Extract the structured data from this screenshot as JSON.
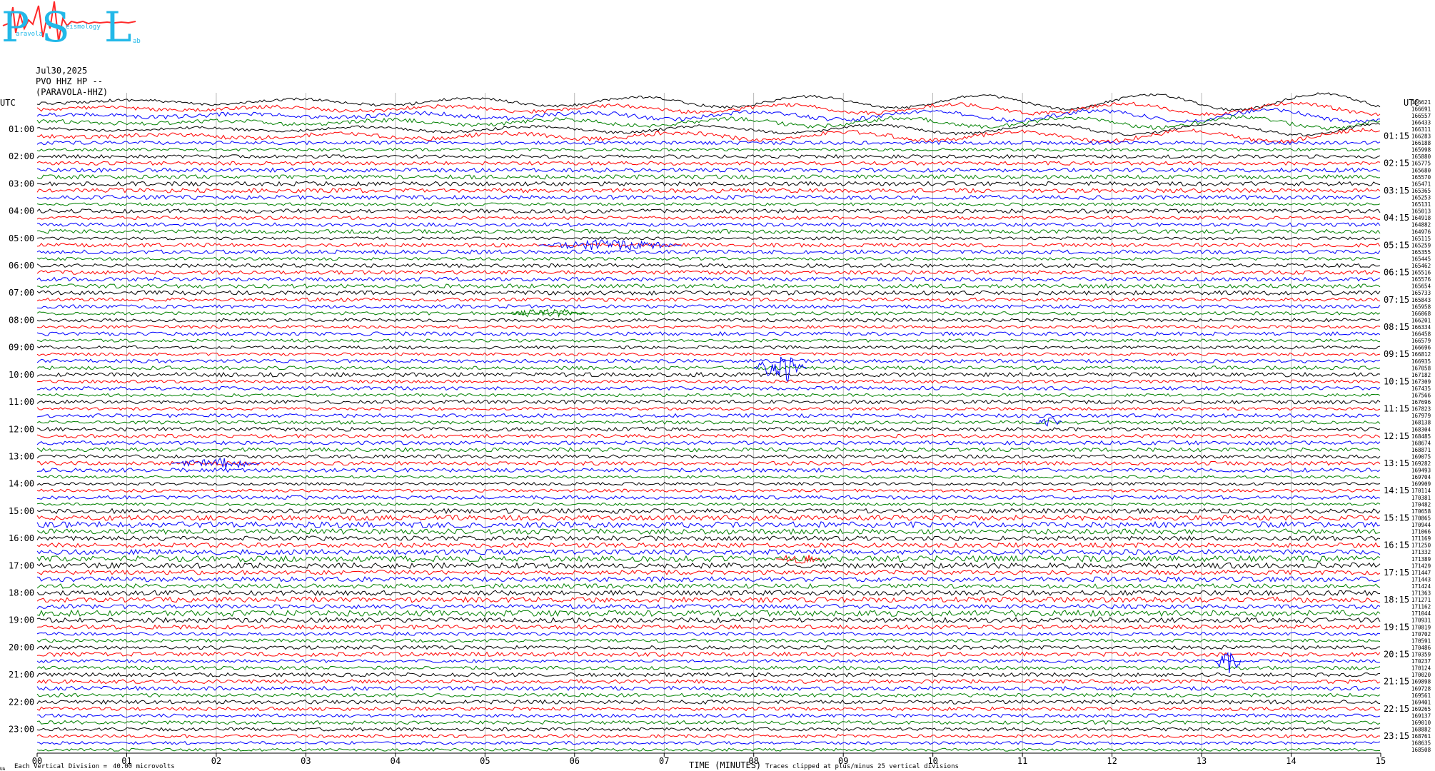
{
  "logo": {
    "letters": [
      "P",
      "S",
      "L"
    ],
    "words": [
      "Paravola",
      "Seismology",
      "Lab"
    ],
    "small_suffixes": [
      "aravola",
      "eismology",
      "ab"
    ],
    "letter_color": "#22b8e8",
    "wave_color": "#ff2a2a"
  },
  "header": {
    "date": "Jul30,2025",
    "station": "PVO HHZ HP --",
    "site": "(PARAVOLA-HHZ)"
  },
  "footer": {
    "corner_mark": "UA",
    "scale_label": "Each Vertical Division =",
    "scale_value": "40.00 microvolts",
    "clip_note": "Traces clipped at plus/minus 25 vertical divisions"
  },
  "chart_data": {
    "type": "line",
    "title": "",
    "xlabel": "TIME (MINUTES)",
    "ylabel_left": "UTC",
    "ylabel_right": "UTC",
    "x_ticks": [
      "00",
      "01",
      "02",
      "03",
      "04",
      "05",
      "06",
      "07",
      "08",
      "09",
      "10",
      "11",
      "12",
      "13",
      "14",
      "15"
    ],
    "xlim": [
      0,
      15
    ],
    "left_hour_labels": [
      "01:00",
      "02:00",
      "03:00",
      "04:00",
      "05:00",
      "06:00",
      "07:00",
      "08:00",
      "09:00",
      "10:00",
      "11:00",
      "12:00",
      "13:00",
      "14:00",
      "15:00",
      "16:00",
      "17:00",
      "18:00",
      "19:00",
      "20:00",
      "21:00",
      "22:00",
      "23:00"
    ],
    "right_hour_labels": [
      "01:15",
      "02:15",
      "03:15",
      "04:15",
      "05:15",
      "06:15",
      "07:15",
      "08:15",
      "09:15",
      "10:15",
      "11:15",
      "12:15",
      "13:15",
      "14:15",
      "15:15",
      "16:15",
      "17:15",
      "18:15",
      "19:15",
      "20:15",
      "21:15",
      "22:15",
      "23:15"
    ],
    "trace_colors": [
      "#000000",
      "#ff0000",
      "#0000ff",
      "#008000"
    ],
    "trace_count": 96,
    "minutes_per_trace": 15,
    "grid": true,
    "right_offsets": [
      166621,
      166691,
      166557,
      166433,
      166311,
      166283,
      166188,
      165998,
      165880,
      165775,
      165680,
      165570,
      165471,
      165365,
      165253,
      165131,
      165013,
      164918,
      164882,
      164976,
      165115,
      165259,
      165355,
      165445,
      165462,
      165516,
      165576,
      165654,
      165733,
      165843,
      165958,
      166068,
      166201,
      166334,
      166458,
      166579,
      166696,
      166812,
      166935,
      167058,
      167182,
      167309,
      167435,
      167566,
      167696,
      167823,
      167979,
      168138,
      168304,
      168485,
      168674,
      168871,
      169075,
      169282,
      169493,
      169704,
      169909,
      170114,
      170381,
      170482,
      170658,
      170865,
      170944,
      171066,
      171169,
      171250,
      171332,
      171389,
      171429,
      171447,
      171443,
      171424,
      171363,
      171271,
      171162,
      171044,
      170931,
      170819,
      170702,
      170591,
      170486,
      170359,
      170237,
      170124,
      170020,
      169898,
      169728,
      169561,
      169401,
      169265,
      169137,
      169010,
      168882,
      168761,
      168635,
      168508
    ]
  }
}
